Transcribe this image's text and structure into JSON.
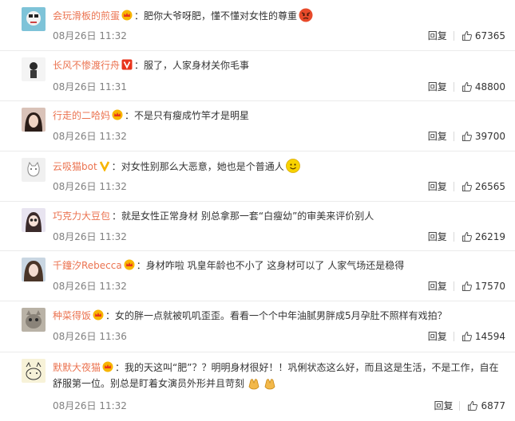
{
  "comments": [
    {
      "user": "会玩滑板的煎蛋",
      "badge": "crown-badge",
      "sep": "：",
      "text": "肥你大爷呀肥，懂不懂对女性的尊重",
      "emoji": "angry-face-emoji",
      "time": "08月26日 11:32",
      "reply": "回复",
      "likes": "67365"
    },
    {
      "user": "长风不惨渡行舟",
      "badge": "verified-v-badge",
      "sep": "：",
      "text": "服了，人家身材关你毛事",
      "emoji": "",
      "time": "08月26日 11:31",
      "reply": "回复",
      "likes": "48800"
    },
    {
      "user": "行走的二哈妈",
      "badge": "crown-badge",
      "sep": "：",
      "text": "不是只有瘦成竹竿才是明星",
      "emoji": "",
      "time": "08月26日 11:32",
      "reply": "回复",
      "likes": "39700"
    },
    {
      "user": "云吸猫bot",
      "badge": "verified-v-badge",
      "sep": "：",
      "text": "对女性别那么大恶意，她也是个普通人",
      "emoji": "smile-emoji",
      "time": "08月26日 11:32",
      "reply": "回复",
      "likes": "26565"
    },
    {
      "user": "巧克力大豆包",
      "badge": "",
      "sep": "：",
      "text": "就是女性正常身材 别总拿那一套“白瘦幼”的审美来评价别人",
      "emoji": "",
      "time": "08月26日 11:32",
      "reply": "回复",
      "likes": "26219"
    },
    {
      "user": "千鐘汐Rebecca",
      "badge": "crown-badge",
      "sep": "：",
      "text": "身材咋啦 巩皇年龄也不小了 这身材可以了 人家气场还是稳得",
      "emoji": "",
      "time": "08月26日 11:32",
      "reply": "回复",
      "likes": "17570"
    },
    {
      "user": "种菜得饭",
      "badge": "crown-badge",
      "sep": "：",
      "text": "女的胖一点就被叽叽歪歪。看看一个个中年油腻男胖成5月孕肚不照样有戏拍？",
      "emoji": "",
      "time": "08月26日 11:36",
      "reply": "回复",
      "likes": "14594"
    },
    {
      "user": "默默大夜猫",
      "badge": "crown-badge",
      "sep": "：",
      "text": "我的天这叫“肥”？？明明身材很好！！巩俐状态这么好，而且这是生活，不是工作，自在舒服第一位。别总是盯着女演员外形并且苛刻",
      "emoji": "clap-emoji",
      "time": "08月26日 11:32",
      "reply": "回复",
      "likes": "6877"
    }
  ],
  "colors": {
    "username": "#eb7350",
    "text": "#333333",
    "time": "#808080",
    "divider": "#ebebeb"
  }
}
